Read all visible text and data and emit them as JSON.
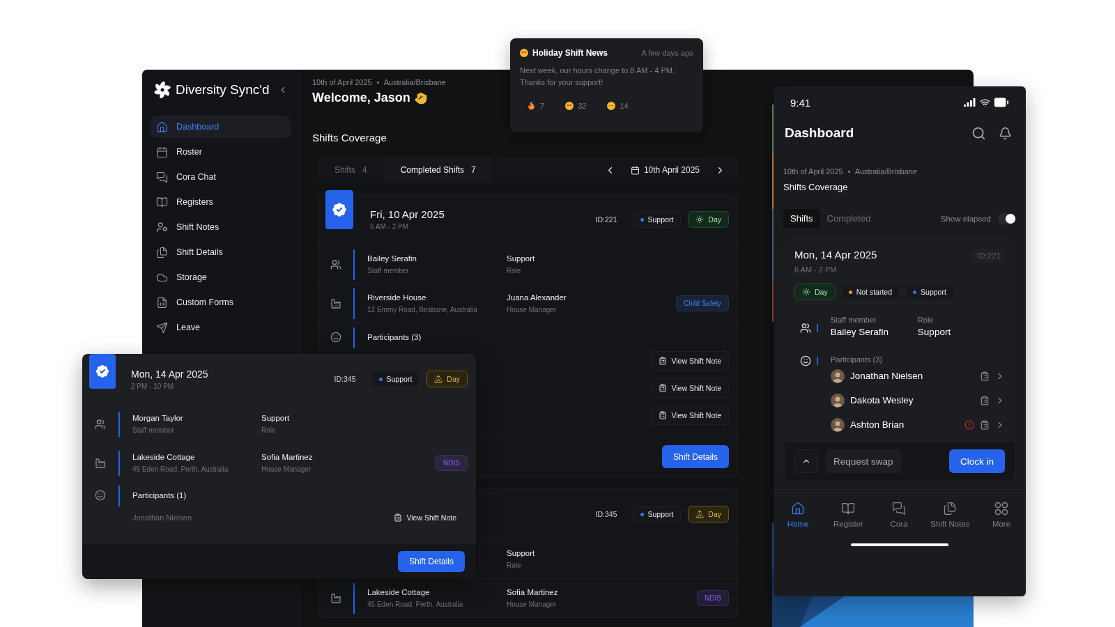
{
  "sidebar": {
    "brand": "Diversity Sync'd",
    "items": [
      {
        "label": "Dashboard",
        "selected": true
      },
      {
        "label": "Roster",
        "selected": false
      },
      {
        "label": "Cora Chat",
        "selected": false
      },
      {
        "label": "Registers",
        "selected": false
      },
      {
        "label": "Shift Notes",
        "selected": false
      },
      {
        "label": "Shift Details",
        "selected": false
      },
      {
        "label": "Storage",
        "selected": false
      },
      {
        "label": "Custom Forms",
        "selected": false
      },
      {
        "label": "Leave",
        "selected": false
      }
    ]
  },
  "main": {
    "date": "10th of April 2025",
    "location": "Australia/Brisbane",
    "welcome": "Welcome, Jason",
    "heading": "Shifts Coverage",
    "tabs": [
      {
        "label": "Shifts",
        "count": "4",
        "selected": false
      },
      {
        "label": "Completed Shifts",
        "count": "7",
        "selected": true
      }
    ],
    "date_picker": "10th April 2025",
    "shifts": [
      {
        "date": "Fri, 10 Apr 2025",
        "time": "6 AM - 2 PM",
        "id": "ID:221",
        "tags": [
          {
            "kind": "status",
            "label": "Support",
            "color": "#3b6ff5"
          },
          {
            "kind": "day",
            "label": "Day"
          }
        ],
        "staff": {
          "name": "Bailey Serafin",
          "caption": "Staff member",
          "role": "Support",
          "role_caption": "Role"
        },
        "location": {
          "name": "Riverside House",
          "address": "12 Emmy Road, Brisbane, Australia",
          "manager": "Juana Alexander",
          "manager_caption": "House Manager",
          "tag": {
            "label": "Child Safety",
            "color": "#3b82f6"
          }
        },
        "participants": {
          "title": "Participants (3)",
          "notes": [
            "View Shift Note",
            "View Shift Note",
            "View Shift Note"
          ]
        },
        "action": "Shift Details"
      },
      {
        "id": "ID:345",
        "tags": [
          {
            "kind": "status",
            "label": "Support",
            "color": "#3b6ff5"
          },
          {
            "kind": "sunset",
            "label": "Day"
          }
        ],
        "staff": {
          "role": "Support",
          "role_caption": "Role"
        },
        "location": {
          "name": "Lakeside Cottage",
          "address": "45 Eden Road, Perth, Australia",
          "manager": "Sofia Martinez",
          "manager_caption": "House Manager",
          "tag": {
            "label": "NDIS",
            "color": "#8b5cf6"
          }
        }
      }
    ]
  },
  "floating_shift": {
    "date": "Mon, 14 Apr 2025",
    "time": "2 PM - 10 PM",
    "id": "ID:345",
    "tags": [
      {
        "kind": "status",
        "label": "Support",
        "color": "#3b6ff5"
      },
      {
        "kind": "sunset",
        "label": "Day"
      }
    ],
    "staff": {
      "name": "Morgan Taylor",
      "caption": "Staff member",
      "role": "Support",
      "role_caption": "Role"
    },
    "location": {
      "name": "Lakeside Cottage",
      "address": "45 Eden Road, Perth, Australia",
      "manager": "Sofia Martinez",
      "manager_caption": "House Manager",
      "tag": {
        "label": "NDIS",
        "color": "#8b5cf6"
      }
    },
    "participants": {
      "title": "Participants (1)",
      "names": [
        "Jonathan Nielsen"
      ],
      "notes": [
        "View Shift Note"
      ]
    },
    "action": "Shift Details"
  },
  "notification": {
    "title": "Holiday Shift News",
    "time": "A few days ago",
    "message": "Next week, our hours change to 8 AM - 4 PM. Thanks for your support!",
    "reactions": [
      {
        "kind": "fire",
        "count": "7"
      },
      {
        "kind": "love",
        "count": "32"
      },
      {
        "kind": "sleepy",
        "count": "14"
      }
    ]
  },
  "phone": {
    "time": "9:41",
    "title": "Dashboard",
    "date": "10th of April 2025",
    "location": "Australia/Brisbane",
    "heading": "Shifts Coverage",
    "segments": [
      {
        "label": "Shifts",
        "selected": true
      },
      {
        "label": "Completed",
        "selected": false
      }
    ],
    "toggle": {
      "label": "Show elapsed",
      "on": true
    },
    "shift": {
      "date": "Mon, 14 Apr 2025",
      "time": "6 AM - 2 PM",
      "id": "ID:221",
      "tags": [
        {
          "kind": "day",
          "label": "Day"
        },
        {
          "kind": "status",
          "label": "Not started",
          "color": "#f59e0b"
        },
        {
          "kind": "status",
          "label": "Support",
          "color": "#3b6ff5"
        }
      ],
      "staff_caption": "Staff member",
      "staff": "Bailey Serafin",
      "role_caption": "Role",
      "role": "Support",
      "participants_title": "Participants (3)",
      "participants": [
        {
          "name": "Jonathan Nielsen",
          "alert": false
        },
        {
          "name": "Dakota Wesley",
          "alert": false
        },
        {
          "name": "Ashton Brian",
          "alert": true
        }
      ]
    },
    "actions": {
      "secondary": "Request swap",
      "primary": "Clock in"
    },
    "nav": [
      {
        "label": "Home",
        "selected": true
      },
      {
        "label": "Register",
        "selected": false
      },
      {
        "label": "Cora",
        "selected": false
      },
      {
        "label": "Shift Notes",
        "selected": false
      },
      {
        "label": "More",
        "selected": false
      }
    ]
  }
}
